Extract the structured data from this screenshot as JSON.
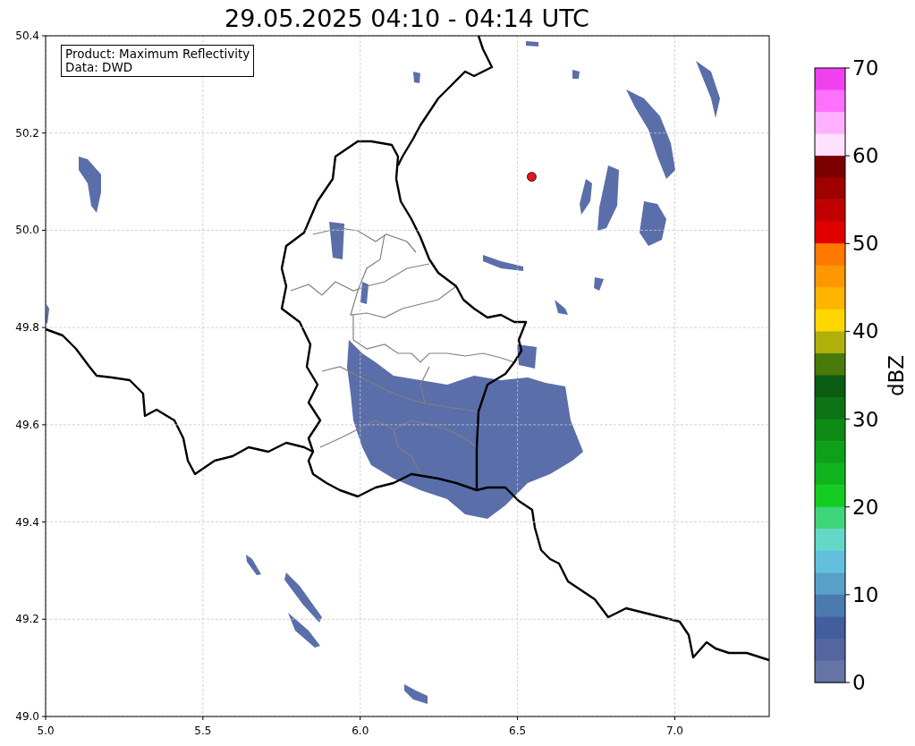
{
  "title": "29.05.2025 04:10 - 04:14 UTC",
  "map": {
    "info_box": [
      "Product: Maximum Reflectivity",
      "Data: DWD"
    ],
    "chart_data": {
      "type": "scatter",
      "grid": true,
      "xlim": [
        5,
        7.3
      ],
      "ylim": [
        49,
        50.4
      ],
      "xticks": [
        {
          "value": 5,
          "label": "5.0"
        },
        {
          "value": 5.5,
          "label": "5.5"
        },
        {
          "value": 6,
          "label": "6.0"
        },
        {
          "value": 6.5,
          "label": "6.5"
        },
        {
          "value": 7,
          "label": "7.0"
        }
      ],
      "yticks": [
        {
          "value": 49,
          "label": "49.0"
        },
        {
          "value": 49.2,
          "label": "49.2"
        },
        {
          "value": 49.4,
          "label": "49.4"
        },
        {
          "value": 49.6,
          "label": "49.6"
        },
        {
          "value": 49.8,
          "label": "49.8"
        },
        {
          "value": 50,
          "label": "50.0"
        },
        {
          "value": 50.2,
          "label": "50.2"
        },
        {
          "value": 50.4,
          "label": "50.4"
        }
      ],
      "series": [
        {
          "color": "#e8141e",
          "x": [
            6.545
          ],
          "values": [
            50.11
          ]
        }
      ]
    }
  },
  "colorbar": {
    "label": "dBZ",
    "ticks": [
      "70",
      "60",
      "50",
      "40",
      "30",
      "20",
      "10",
      "0"
    ],
    "bands": [
      {
        "color": "#f040f0"
      },
      {
        "color": "#ff70ff"
      },
      {
        "color": "#ffb0ff"
      },
      {
        "color": "#ffe0ff"
      },
      {
        "color": "#7c0000"
      },
      {
        "color": "#a00000"
      },
      {
        "color": "#c00000"
      },
      {
        "color": "#e00000"
      },
      {
        "color": "#ff7800"
      },
      {
        "color": "#ff9800"
      },
      {
        "color": "#ffb400"
      },
      {
        "color": "#ffd700"
      },
      {
        "color": "#b0b00c"
      },
      {
        "color": "#4a7a0a"
      },
      {
        "color": "#0a5c10"
      },
      {
        "color": "#0c7414"
      },
      {
        "color": "#0c8a14"
      },
      {
        "color": "#0ea018"
      },
      {
        "color": "#10b41c"
      },
      {
        "color": "#14cc20"
      },
      {
        "color": "#3ed67a"
      },
      {
        "color": "#64d8c8"
      },
      {
        "color": "#62c0dc"
      },
      {
        "color": "#58a0c8"
      },
      {
        "color": "#4a7ab0"
      },
      {
        "color": "#435e9e"
      },
      {
        "color": "#5466a0"
      },
      {
        "color": "#6474a6"
      }
    ]
  }
}
